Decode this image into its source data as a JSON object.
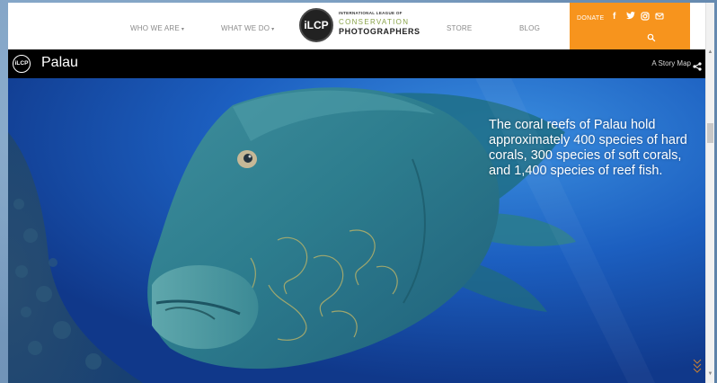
{
  "nav": {
    "items": [
      {
        "label": "WHO WE ARE",
        "has_dropdown": true
      },
      {
        "label": "WHAT WE DO",
        "has_dropdown": true
      },
      {
        "label": "STORE",
        "has_dropdown": false
      },
      {
        "label": "BLOG",
        "has_dropdown": false
      }
    ],
    "logo": {
      "badge_text": "iLCP",
      "line1": "INTERNATIONAL LEAGUE OF",
      "line2": "CONSERVATION",
      "line3": "PHOTOGRAPHERS"
    },
    "donate_label": "DONATE",
    "social_icons": [
      "facebook-icon",
      "twitter-icon",
      "instagram-icon",
      "mail-icon"
    ],
    "accent_color": "#f7941d"
  },
  "story": {
    "logo_text": "iLCP",
    "title": "Palau",
    "subtitle": "A Story Map",
    "share_icon": "share-icon"
  },
  "hero": {
    "caption": "The coral reefs of Palau hold approximately 400 species of hard corals, 300 species of soft corals, and 1,400 species of reef fish.",
    "scroll_icon": "chevron-down-double-icon"
  }
}
